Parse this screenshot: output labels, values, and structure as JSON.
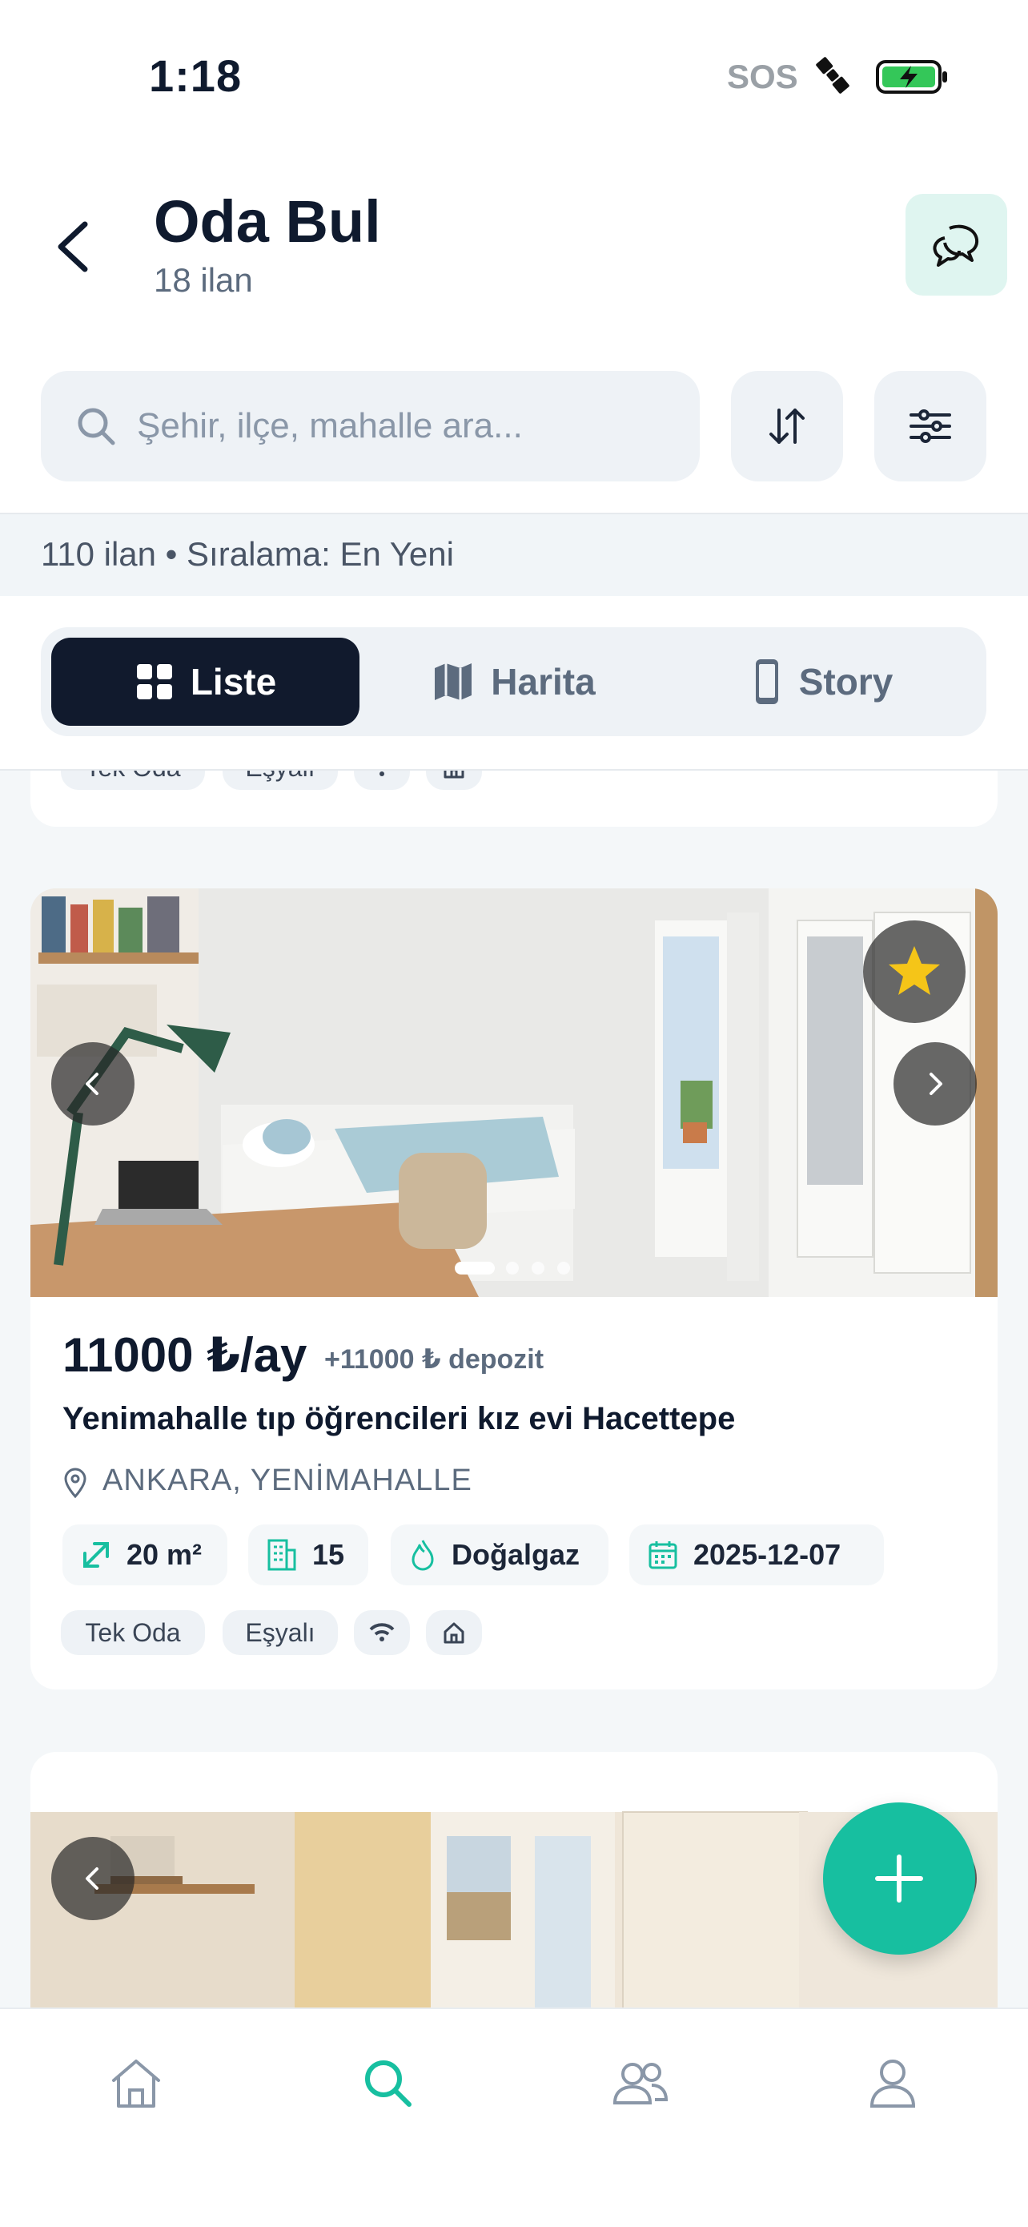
{
  "status_bar": {
    "time": "1:18",
    "sos": "SOS",
    "icons": [
      "satellite-icon",
      "battery-charging-icon"
    ]
  },
  "header": {
    "title": "Oda Bul",
    "subtitle": "18 ilan",
    "back_icon": "chevron-left-icon",
    "chat_icon": "chat-bubbles-icon"
  },
  "search": {
    "placeholder": "Şehir, ilçe, mahalle ara...",
    "value": "",
    "sort_icon": "sort-arrows-icon",
    "filter_icon": "sliders-icon"
  },
  "info_strip": {
    "text": "110 ilan • Sıralama: En Yeni"
  },
  "view_tabs": [
    {
      "label": "Liste",
      "icon": "grid-icon",
      "active": true
    },
    {
      "label": "Harita",
      "icon": "map-icon",
      "active": false
    },
    {
      "label": "Story",
      "icon": "phone-icon",
      "active": false
    }
  ],
  "previous_card": {
    "tags": [
      "Tek Oda",
      "Eşyalı"
    ],
    "tag_icons": [
      "wifi-icon",
      "home-icon"
    ]
  },
  "listing": {
    "price": "11000 ₺/ay",
    "deposit": "+11000 ₺ depozit",
    "title": "Yenimahalle tıp öğrencileri kız evi Hacettepe",
    "location": "ANKARA, YENİMAHALLE",
    "favorite": true,
    "photo_index": 1,
    "photo_count": 4,
    "features": [
      {
        "icon": "resize-icon",
        "label": "20 m²"
      },
      {
        "icon": "building-icon",
        "label": "15"
      },
      {
        "icon": "flame-icon",
        "label": "Doğalgaz"
      },
      {
        "icon": "calendar-icon",
        "label": "2025-12-07"
      }
    ],
    "tags": [
      "Tek Oda",
      "Eşyalı"
    ],
    "tag_icons": [
      "wifi-icon",
      "home-icon"
    ]
  },
  "colors": {
    "accent": "#17bfa0",
    "dark": "#111a2d",
    "muted": "#5c6b7e",
    "favorite": "#f5c518"
  },
  "tab_bar": [
    {
      "name": "home",
      "icon": "home-icon",
      "active": false
    },
    {
      "name": "search",
      "icon": "search-icon",
      "active": true
    },
    {
      "name": "people",
      "icon": "users-icon",
      "active": false
    },
    {
      "name": "profile",
      "icon": "user-icon",
      "active": false
    }
  ]
}
